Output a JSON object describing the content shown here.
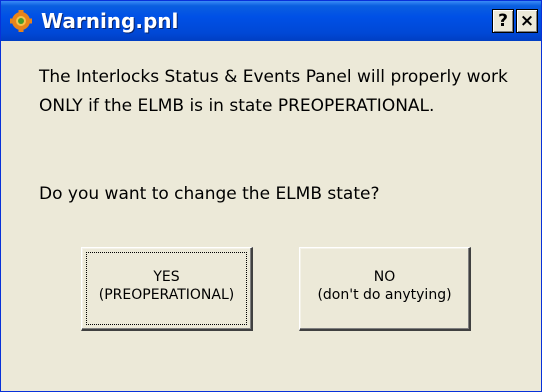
{
  "window": {
    "title": "Warning.pnl",
    "title_icon": "gear-icon",
    "help_label": "?",
    "close_label": "×"
  },
  "message": {
    "line1": "The Interlocks Status & Events Panel will properly work",
    "line2": "ONLY if the ELMB is in state PREOPERATIONAL.",
    "question": "Do you want to change the ELMB state?"
  },
  "buttons": {
    "yes": {
      "line1": "YES",
      "line2": "(PREOPERATIONAL)"
    },
    "no": {
      "line1": "NO",
      "line2": "(don't do anytying)"
    }
  },
  "colors": {
    "titlebar": "#0050e6",
    "dialog_bg": "#ece9d8",
    "icon_orange": "#e8841a",
    "icon_green": "#4a9a2a"
  }
}
